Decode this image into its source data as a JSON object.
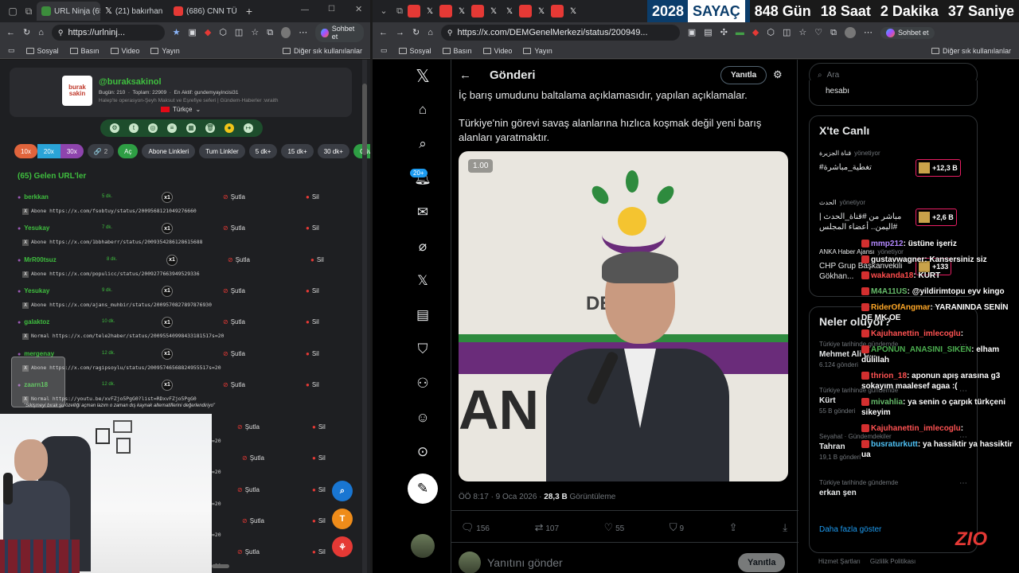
{
  "left_browser": {
    "tabs": [
      {
        "label": "URL Ninja (65)",
        "active": true
      },
      {
        "label": "(21) bakırhan",
        "active": false
      },
      {
        "label": "(686) CNN TÜR",
        "active": false
      }
    ],
    "url": "https://urlninj...",
    "copilot_label": "Sohbet et",
    "bookmarks": [
      "Sosyal",
      "Basın",
      "Video",
      "Yayın"
    ],
    "other_bookmarks": "Diğer sık kullanılanlar"
  },
  "url_app": {
    "logo_text": "burak sakin",
    "handle": "@buraksakinol",
    "stats": "Bugün: 210  ·  Toplam: 22909  ·  En Aktif: gundemyayincisi31",
    "bio": "Halep'te operasyon-Şeyh Maksut ve Eşrefiye seferi | Gündem-Haberler :wraith",
    "language": "Türkçe",
    "multipliers": [
      "10x",
      "20x",
      "30x"
    ],
    "link_count": "2",
    "buttons": [
      "Aç",
      "Abone Linkleri",
      "Tum Linkler",
      "5 dk+",
      "15 dk+",
      "30 dk+",
      "Güvenli"
    ],
    "section_title": "(65) Gelen URL'ler",
    "spam_label": "Şutla",
    "delete_label": "Sil",
    "x1_label": "x1",
    "rows": [
      {
        "user": "berkkan",
        "time": "5 dk.",
        "url": "Abone https://x.com/fsobtuy/status/2009568121049276660"
      },
      {
        "user": "Yesukay",
        "time": "7 dk.",
        "url": "Abone https://x.com/1bbhaberr/status/2009354286128615688"
      },
      {
        "user": "MrR00tsuz",
        "time": "8 dk.",
        "url": "Abone https://x.com/populicc/status/2009277663949529336"
      },
      {
        "user": "Yesukay",
        "time": "9 dk.",
        "url": "Abone https://x.com/ajans_muhbir/status/2009570827897876930"
      },
      {
        "user": "galaktoz",
        "time": "10 dk.",
        "url": "Normal https://x.com/tele2haber/status/20095540998433181517s=20"
      },
      {
        "user": "mergenay",
        "time": "12 dk.",
        "url": "Abone https://x.com/ragipsoylu/status/20095746568824955517s=20"
      },
      {
        "user": "zaarn18",
        "time": "12 dk.",
        "url": "Normal https://youtu.be/xvFZjo5PgG0?list=RDxvFZjo5PgG0"
      }
    ],
    "comment": "\"Sikişmeyi bırak şu özelliği açman lazım o zaman dış kaynak alternatiflerini değerlendiriyo\"",
    "extra_rows": 5,
    "extra_suffix": "=20",
    "fab_letter": "T"
  },
  "right_browser": {
    "url": "https://x.com/DEMGenelMerkezi/status/200949...",
    "copilot_label": "Sohbet et",
    "bookmarks": [
      "Sosyal",
      "Basın",
      "Video",
      "Yayın"
    ],
    "other_bookmarks": "Diğer sık kullanılanlar"
  },
  "countdown": [
    {
      "value": "2028",
      "label": "SAYAÇ"
    },
    {
      "value": "848",
      "label": "Gün"
    },
    {
      "value": "18",
      "label": "Saat"
    },
    {
      "value": "2",
      "label": "Dakika"
    },
    {
      "value": "37",
      "label": "Saniye"
    }
  ],
  "x": {
    "notif_badge": "20+",
    "header_title": "Gönderi",
    "reply_button": "Yanıtla",
    "tweet_line1": "İç barış umudunu baltalama açıklamasıdır, yapılan açıklamalar.",
    "tweet_line2": "Türkiye'nin görevi savaş alanlarına hızlıca koşmak değil yeni barış alanları yaratmaktır.",
    "video_speed": "1.00",
    "banner_text": "DEM",
    "banner_text_left": "AN",
    "timestamp": "ÖÖ 8:17 · 9 Oca 2026 · ",
    "views": "28,3 B",
    "views_label": "Görüntüleme",
    "replies": "156",
    "reposts": "107",
    "likes": "55",
    "bookmarks": "9",
    "reply_placeholder": "Yanıtını gönder",
    "reply_send": "Yanıtla",
    "search_placeholder": "Ara",
    "top_card_text": "hesabı",
    "live_title": "X'te Canlı",
    "live_items": [
      {
        "host": "قناة الجزيرة",
        "role": "yönetiyor",
        "title": "#تغطية_مباشرة",
        "count": "+12,3 B"
      },
      {
        "host": "الحدث",
        "role": "yönetiyor",
        "title": "مباشر من #قناة_الحدث | #اليمن.. أعضاء المجلس",
        "count": "+2,6 B"
      },
      {
        "host": "ANKA Haber Ajansı",
        "role": "yönetiyor",
        "title": "CHP Grup Başkanvekili Gökhan...",
        "count": "+133"
      }
    ],
    "trends_title": "Neler oluyor?",
    "trends": [
      {
        "context": "Türkiye tarihinde gündemde",
        "name": "Mehmet Ali Ç...",
        "count": "6.124 gönderi"
      },
      {
        "context": "Türkiye tarihinde gündemde",
        "name": "Kürt",
        "count": "55 B gönderi"
      },
      {
        "context": "Seyahat · Gündemdekiler",
        "name": "Tahran",
        "count": "19,1 B gönderi"
      },
      {
        "context": "Türkiye tarihinde gündemde",
        "name": "erkan şen",
        "count": ""
      }
    ],
    "show_more": "Daha fazla göster",
    "footer": [
      "Hizmet Şartları",
      "Gizlilik Politikası"
    ]
  },
  "chat": [
    {
      "user": "mmp212",
      "text": "üstüne işeriz",
      "color": "#b388ff"
    },
    {
      "user": "gustavwagner",
      "text": "Kansersiniz siz",
      "color": "#ffffff"
    },
    {
      "user": "wakanda18",
      "text": "KURT",
      "color": "#ff4d4d"
    },
    {
      "user": "M4A11US",
      "text": "@yildirimtopu eyv kingo",
      "color": "#66bb6a"
    },
    {
      "user": "RiderOfAngmar",
      "text": "YARANINDA SENİN DE MK OE",
      "color": "#ffa726"
    },
    {
      "user": "Kajuhanettin_imlecoglu",
      "text": "",
      "color": "#ff5252"
    },
    {
      "user": "APONUN_ANASINI_SIKEN",
      "text": "elham dülillah",
      "color": "#4caf50"
    },
    {
      "user": "thrion_18",
      "text": "aponun apış arasına g3 sokayım maalesef agaa :(",
      "color": "#ff5252"
    },
    {
      "user": "mivahlia",
      "text": "ya senin o çarpık türkçeni sikeyim",
      "color": "#66bb6a"
    },
    {
      "user": "Kajuhanettin_imlecoglu",
      "text": "",
      "color": "#ff5252"
    },
    {
      "user": "busraturkutt",
      "text": "ya hassiktir ya hassiktir ua",
      "color": "#4fc3f7"
    }
  ],
  "brand_overlay": "ZIO"
}
